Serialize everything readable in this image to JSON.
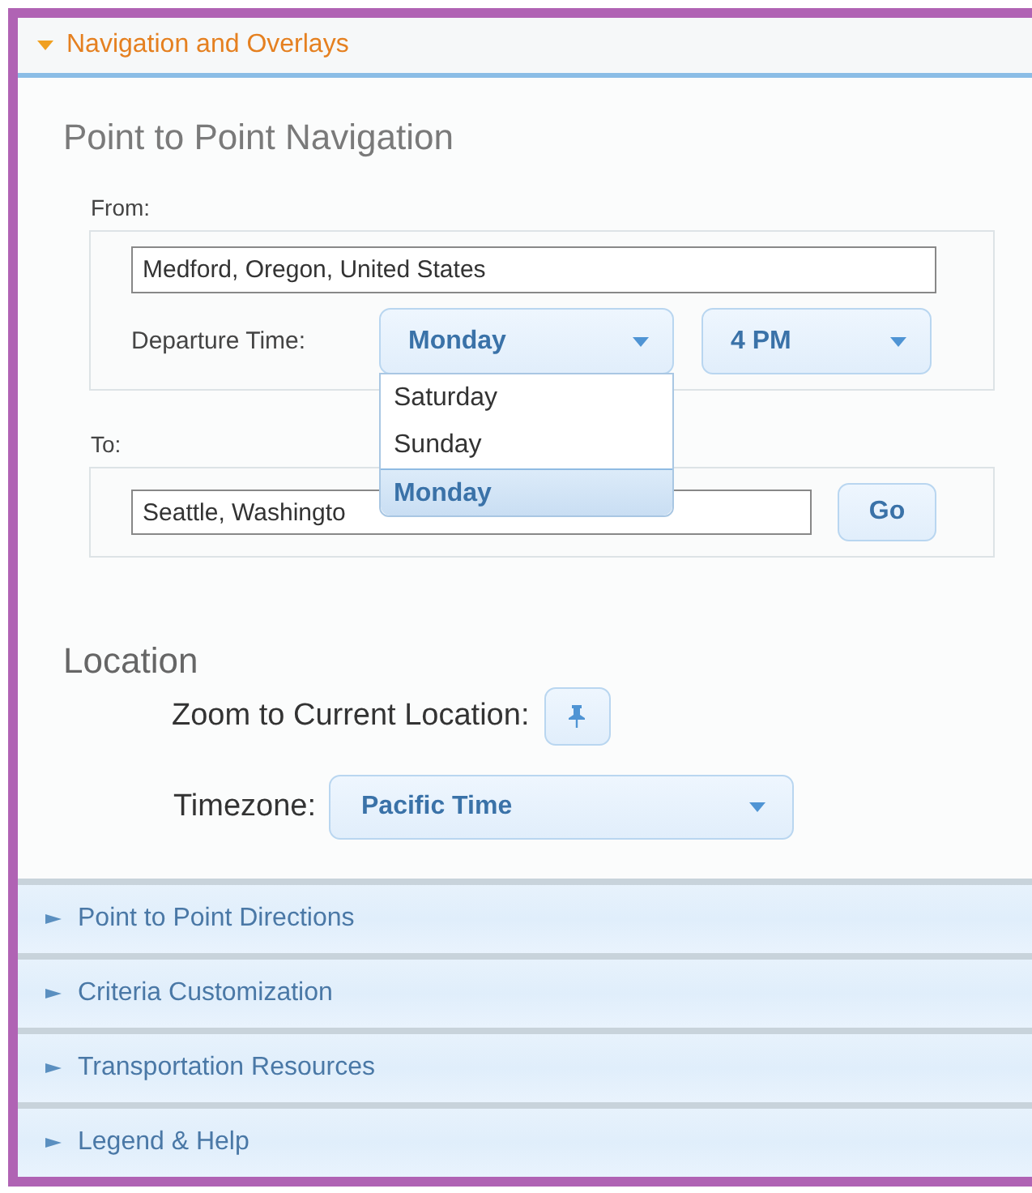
{
  "panel": {
    "title": "Navigation and Overlays",
    "expanded": true
  },
  "navigation": {
    "heading": "Point to Point Navigation",
    "from": {
      "label": "From:",
      "value": "Medford, Oregon, United States"
    },
    "departure": {
      "label": "Departure Time:",
      "day": "Monday",
      "hour": "4 PM",
      "day_options": [
        {
          "label": "Saturday",
          "selected": false
        },
        {
          "label": "Sunday",
          "selected": false
        },
        {
          "label": "Monday",
          "selected": true
        }
      ]
    },
    "to": {
      "label": "To:",
      "value": "Seattle, Washingto"
    },
    "go_button": "Go"
  },
  "location": {
    "heading": "Location",
    "zoom_label": "Zoom to Current Location:",
    "timezone_label": "Timezone:",
    "timezone": "Pacific Time"
  },
  "sections": [
    {
      "title": "Point to Point Directions",
      "expanded": false
    },
    {
      "title": "Criteria Customization",
      "expanded": false
    },
    {
      "title": "Transportation Resources",
      "expanded": false
    },
    {
      "title": "Legend & Help",
      "expanded": false
    }
  ]
}
